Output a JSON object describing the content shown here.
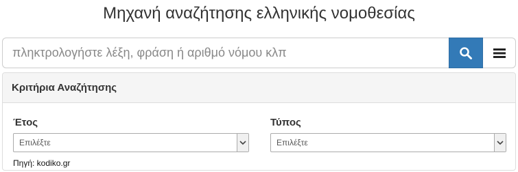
{
  "header": {
    "title": "Μηχανή αναζήτησης ελληνικής νομοθεσίας"
  },
  "search": {
    "placeholder": "πληκτρολογήστε λέξη, φράση ή αριθμό νόμου κλπ"
  },
  "icons": {
    "search": "search-icon",
    "menu": "hamburger-menu-icon",
    "dropdown": "chevron-down-icon"
  },
  "colors": {
    "accent": "#337ab7",
    "panel_heading_bg": "#f5f5f5"
  },
  "panel": {
    "heading": "Κριτήρια Αναζήτησης",
    "year": {
      "label": "Έτος",
      "selected": "Επιλέξτε"
    },
    "type": {
      "label": "Τύπος",
      "selected": "Επιλέξτε"
    },
    "source": "Πηγή: kodiko.gr"
  }
}
